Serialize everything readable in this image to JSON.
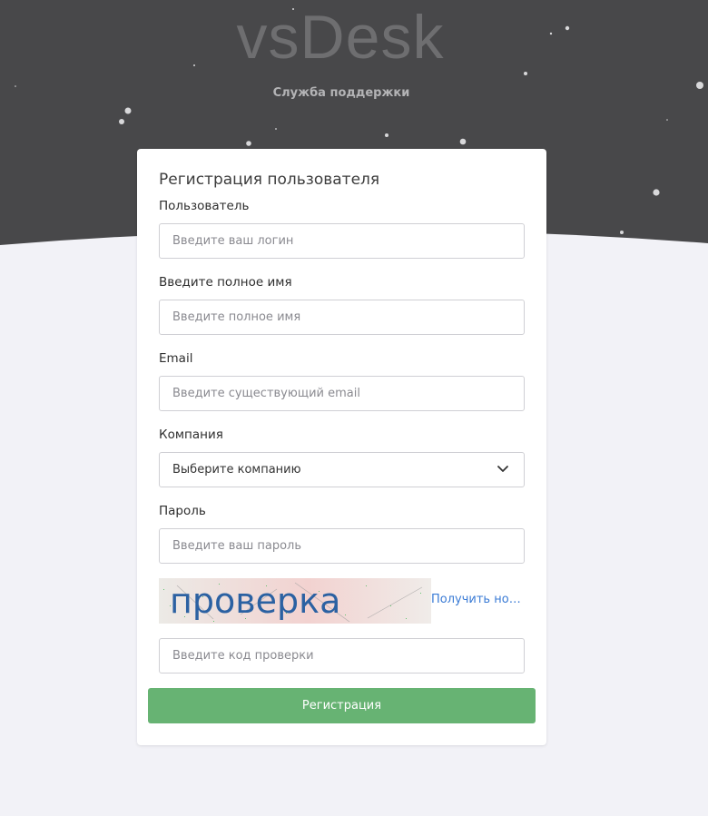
{
  "header": {
    "logo_text": "vsDesk",
    "subtitle": "Служба поддержки"
  },
  "form": {
    "title": "Регистрация пользователя",
    "username": {
      "label": "Пользователь",
      "placeholder": "Введите ваш логин"
    },
    "fullname": {
      "label": "Введите полное имя",
      "placeholder": "Введите полное имя"
    },
    "email": {
      "label": "Email",
      "placeholder": "Введите существующий email"
    },
    "company": {
      "label": "Компания",
      "selected": "Выберите компанию"
    },
    "password": {
      "label": "Пароль",
      "placeholder": "Введите ваш пароль"
    },
    "captcha": {
      "image_text": "проверка",
      "refresh_label": "Получить новый код",
      "placeholder": "Введите код проверки"
    },
    "submit_label": "Регистрация"
  },
  "colors": {
    "header_bg": "#48484a",
    "page_bg": "#f2f2f7",
    "accent_green": "#67b373",
    "link_blue": "#3a7bd5"
  },
  "icons": {
    "select_arrow": "chevron-down-icon"
  }
}
